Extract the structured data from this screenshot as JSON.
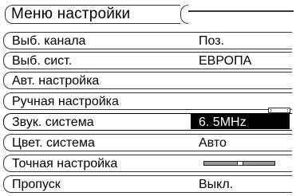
{
  "menu": {
    "title": "Меню настройки",
    "rows": [
      {
        "label": "Выб. канала",
        "value": "Поз."
      },
      {
        "label": "Выб. сист.",
        "value": "ЕВРОПА"
      },
      {
        "label": "Авт. настройка",
        "value": ""
      },
      {
        "label": "Ручная настройка",
        "value": ""
      },
      {
        "label": "Звук. система",
        "value": "6. 5MHz",
        "selected": true
      },
      {
        "label": "Цвет. система",
        "value": "Авто"
      },
      {
        "label": "Точная настройка",
        "value": "",
        "slider_fraction": 0.5
      },
      {
        "label": "Пропуск",
        "value": "Выкл."
      }
    ]
  }
}
